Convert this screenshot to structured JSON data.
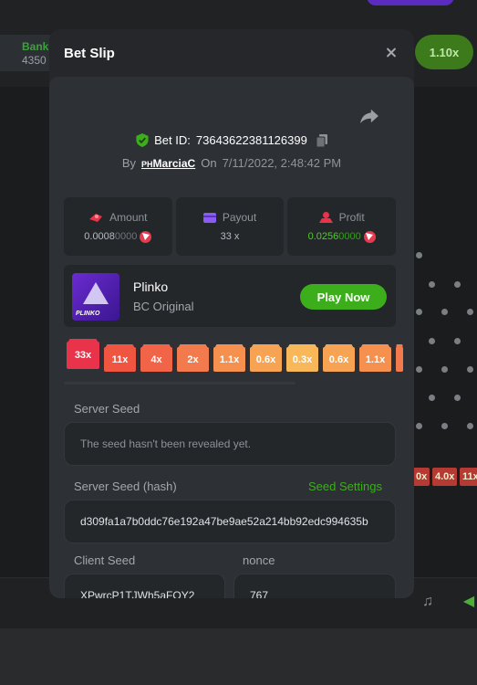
{
  "background": {
    "bank_label": "Bank",
    "bank_value": "4350",
    "multiplier_pill": "1.10x",
    "bottom_chips": [
      "0x",
      "4.0x",
      "11x"
    ]
  },
  "modal": {
    "title": "Bet Slip",
    "bet_id_label": "Bet ID:",
    "bet_id": "73643622381126399",
    "by_label": "By",
    "user_prefix": "PH",
    "username": "MarciaC",
    "on_label": "On",
    "datetime": "7/11/2022, 2:48:42 PM",
    "stats": {
      "amount": {
        "label": "Amount",
        "value_main": "0.0008",
        "value_dim": "0000"
      },
      "payout": {
        "label": "Payout",
        "value": "33 x"
      },
      "profit": {
        "label": "Profit",
        "value_main": "0.0256",
        "value_dim": "0000"
      }
    },
    "game": {
      "name": "Plinko",
      "provider": "BC Original",
      "thumb_label": "PLINKO",
      "play_label": "Play Now"
    },
    "multipliers": [
      "33x",
      "11x",
      "4x",
      "2x",
      "1.1x",
      "0.6x",
      "0.3x",
      "0.6x",
      "1.1x"
    ],
    "server_seed": {
      "label": "Server Seed",
      "value": "The seed hasn't been revealed yet."
    },
    "server_seed_hash": {
      "label": "Server Seed (hash)",
      "settings_link": "Seed Settings",
      "value": "d309fa1a7b0ddc76e192a47be9ae52a214bb92edc994635b"
    },
    "client_seed": {
      "label": "Client Seed",
      "value": "XPwrcP1TJWh5aFOY2"
    },
    "nonce": {
      "label": "nonce",
      "value": "767"
    }
  },
  "colors": {
    "accent_green": "#3cae1c",
    "trx_red": "#e33b4f",
    "multiplier_colors": [
      "#e8334b",
      "#f05542",
      "#f26447",
      "#f37a4c",
      "#f5904f",
      "#f6a453",
      "#f8b85a",
      "#f6a453",
      "#f5904f"
    ]
  }
}
